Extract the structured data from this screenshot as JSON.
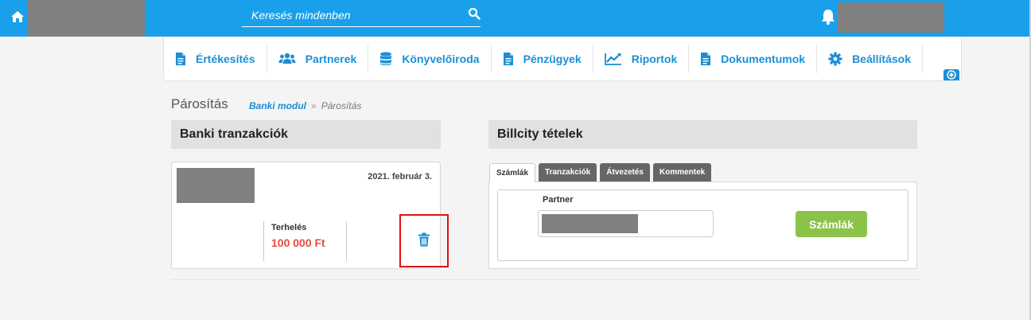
{
  "header": {
    "search_placeholder": "Keresés mindenben"
  },
  "nav": {
    "items": [
      {
        "label": "Értékesítés",
        "icon": "document-icon"
      },
      {
        "label": "Partnerek",
        "icon": "users-icon"
      },
      {
        "label": "Könyvelőiroda",
        "icon": "database-icon"
      },
      {
        "label": "Pénzügyek",
        "icon": "document-icon"
      },
      {
        "label": "Riportok",
        "icon": "line-chart-icon"
      },
      {
        "label": "Dokumentumok",
        "icon": "document-icon"
      },
      {
        "label": "Beállítások",
        "icon": "gear-icon"
      }
    ]
  },
  "page": {
    "title": "Párosítás",
    "breadcrumb": {
      "link": "Banki modul",
      "separator": "»",
      "current": "Párosítás"
    }
  },
  "left_panel": {
    "title": "Banki tranzakciók",
    "transaction": {
      "date": "2021. február 3.",
      "type_label": "Terhelés",
      "amount": "100 000 Ft"
    }
  },
  "right_panel": {
    "title": "Billcity tételek",
    "tabs": [
      {
        "label": "Számlák",
        "active": true
      },
      {
        "label": "Tranzakciók",
        "active": false
      },
      {
        "label": "Átvezetés",
        "active": false
      },
      {
        "label": "Kommentek",
        "active": false
      }
    ],
    "partner_label": "Partner",
    "button_label": "Számlák"
  },
  "colors": {
    "primary": "#1aa0ea",
    "link": "#1a8fd6",
    "success": "#8bc34a",
    "danger": "#e74c3c",
    "highlight": "#e01010"
  }
}
